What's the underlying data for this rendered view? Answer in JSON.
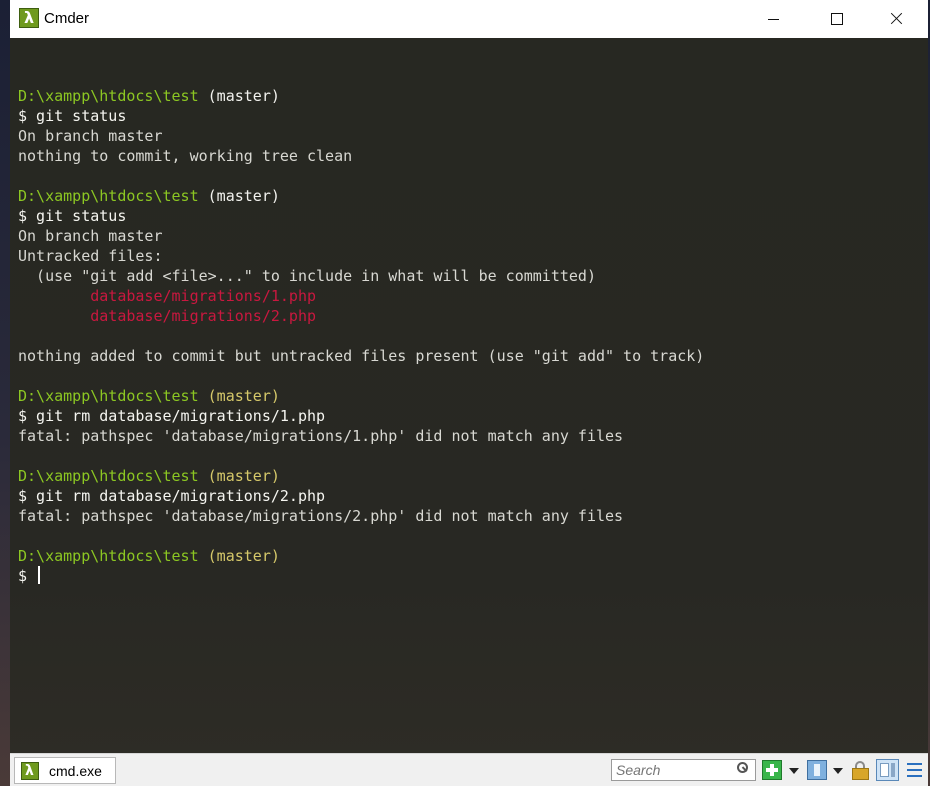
{
  "window": {
    "title": "Cmder",
    "icon": "lambda-icon",
    "icon_glyph": "λ",
    "controls": {
      "minimize": "minimize-icon",
      "maximize": "maximize-icon",
      "close": "close-icon"
    }
  },
  "colors": {
    "terminal_bg": "#272822",
    "path": "#8cc722",
    "branch": "#f2f2ee",
    "branch_dim": "#d6c96a",
    "text": "#d8d8d2",
    "untracked": "#c9183f",
    "accent_green": "#39b54a"
  },
  "terminal": {
    "lines": [
      {
        "segments": []
      },
      {
        "segments": [
          {
            "text": "D:\\xampp\\htdocs\\test",
            "style": "path"
          },
          {
            "text": " ",
            "style": "out"
          },
          {
            "text": "(master)",
            "style": "branch-w"
          }
        ]
      },
      {
        "segments": [
          {
            "text": "$ git status",
            "style": "cmd"
          }
        ]
      },
      {
        "segments": [
          {
            "text": "On branch master",
            "style": "out"
          }
        ]
      },
      {
        "segments": [
          {
            "text": "nothing to commit, working tree clean",
            "style": "out"
          }
        ]
      },
      {
        "segments": []
      },
      {
        "segments": [
          {
            "text": "D:\\xampp\\htdocs\\test",
            "style": "path"
          },
          {
            "text": " ",
            "style": "out"
          },
          {
            "text": "(master)",
            "style": "branch-w"
          }
        ]
      },
      {
        "segments": [
          {
            "text": "$ git status",
            "style": "cmd"
          }
        ]
      },
      {
        "segments": [
          {
            "text": "On branch master",
            "style": "out"
          }
        ]
      },
      {
        "segments": [
          {
            "text": "Untracked files:",
            "style": "out"
          }
        ]
      },
      {
        "segments": [
          {
            "text": "  (use \"git add <file>...\" to include in what will be committed)",
            "style": "out"
          }
        ]
      },
      {
        "segments": [
          {
            "text": "        database/migrations/1.php",
            "style": "red"
          }
        ]
      },
      {
        "segments": [
          {
            "text": "        database/migrations/2.php",
            "style": "red"
          }
        ]
      },
      {
        "segments": []
      },
      {
        "segments": [
          {
            "text": "nothing added to commit but untracked files present (use \"git add\" to track)",
            "style": "out"
          }
        ]
      },
      {
        "segments": []
      },
      {
        "segments": [
          {
            "text": "D:\\xampp\\htdocs\\test",
            "style": "path"
          },
          {
            "text": " ",
            "style": "out"
          },
          {
            "text": "(master)",
            "style": "branch-y"
          }
        ]
      },
      {
        "segments": [
          {
            "text": "$ git rm database/migrations/1.php",
            "style": "cmd"
          }
        ]
      },
      {
        "segments": [
          {
            "text": "fatal: pathspec 'database/migrations/1.php' did not match any files",
            "style": "out"
          }
        ]
      },
      {
        "segments": []
      },
      {
        "segments": [
          {
            "text": "D:\\xampp\\htdocs\\test",
            "style": "path"
          },
          {
            "text": " ",
            "style": "out"
          },
          {
            "text": "(master)",
            "style": "branch-y"
          }
        ]
      },
      {
        "segments": [
          {
            "text": "$ git rm database/migrations/2.php",
            "style": "cmd"
          }
        ]
      },
      {
        "segments": [
          {
            "text": "fatal: pathspec 'database/migrations/2.php' did not match any files",
            "style": "out"
          }
        ]
      },
      {
        "segments": []
      },
      {
        "segments": [
          {
            "text": "D:\\xampp\\htdocs\\test",
            "style": "path"
          },
          {
            "text": " ",
            "style": "out"
          },
          {
            "text": "(master)",
            "style": "branch-y"
          }
        ]
      },
      {
        "segments": [
          {
            "text": "$ ",
            "style": "cmd"
          }
        ],
        "cursor": true
      }
    ]
  },
  "statusbar": {
    "tab_label": "cmd.exe",
    "tab_icon": "lambda-icon",
    "search_placeholder": "Search",
    "toolbar_icons": [
      "search-icon",
      "add-console-icon",
      "dropdown-icon",
      "split-icon",
      "dropdown-icon",
      "lock-icon",
      "pane-icon",
      "menu-icon"
    ]
  }
}
